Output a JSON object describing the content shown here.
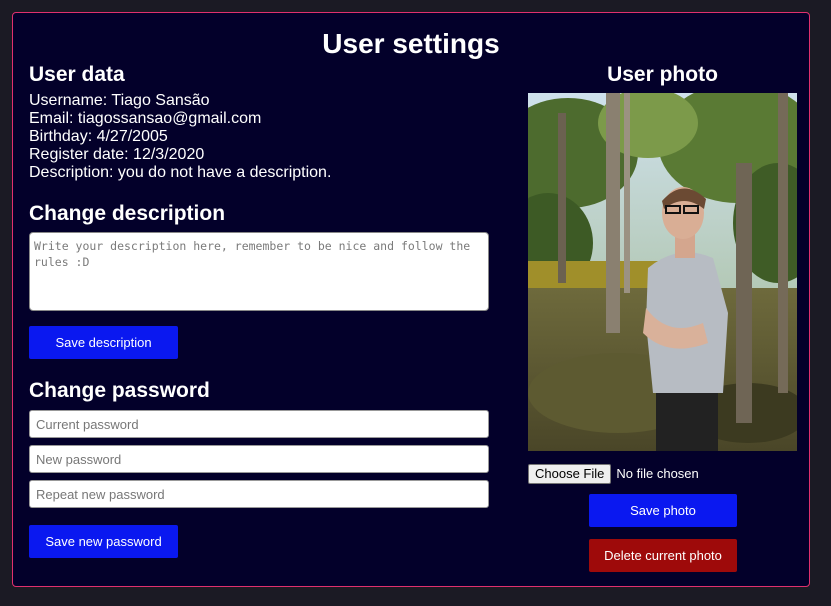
{
  "page": {
    "title": "User settings"
  },
  "user_data": {
    "heading": "User data",
    "username": "Username: Tiago Sansão",
    "email": "Email: tiagossansao@gmail.com",
    "birthday": "Birthday: 4/27/2005",
    "register_date": "Register date: 12/3/2020",
    "description": "Description: you do not have a description."
  },
  "change_description": {
    "heading": "Change description",
    "placeholder": "Write your description here, remember to be nice and follow the rules :D",
    "save_label": "Save description"
  },
  "change_password": {
    "heading": "Change password",
    "current_placeholder": "Current password",
    "new_placeholder": "New password",
    "repeat_placeholder": "Repeat new password",
    "save_label": "Save new password"
  },
  "user_photo": {
    "heading": "User photo",
    "choose_file_label": "Choose File",
    "no_file_text": "No file chosen",
    "save_label": "Save photo",
    "delete_label": "Delete current photo"
  },
  "colors": {
    "panel_bg": "#03002a",
    "border": "#e0306e",
    "primary_button": "#0a18f0",
    "danger_button": "#9e0a0a"
  }
}
